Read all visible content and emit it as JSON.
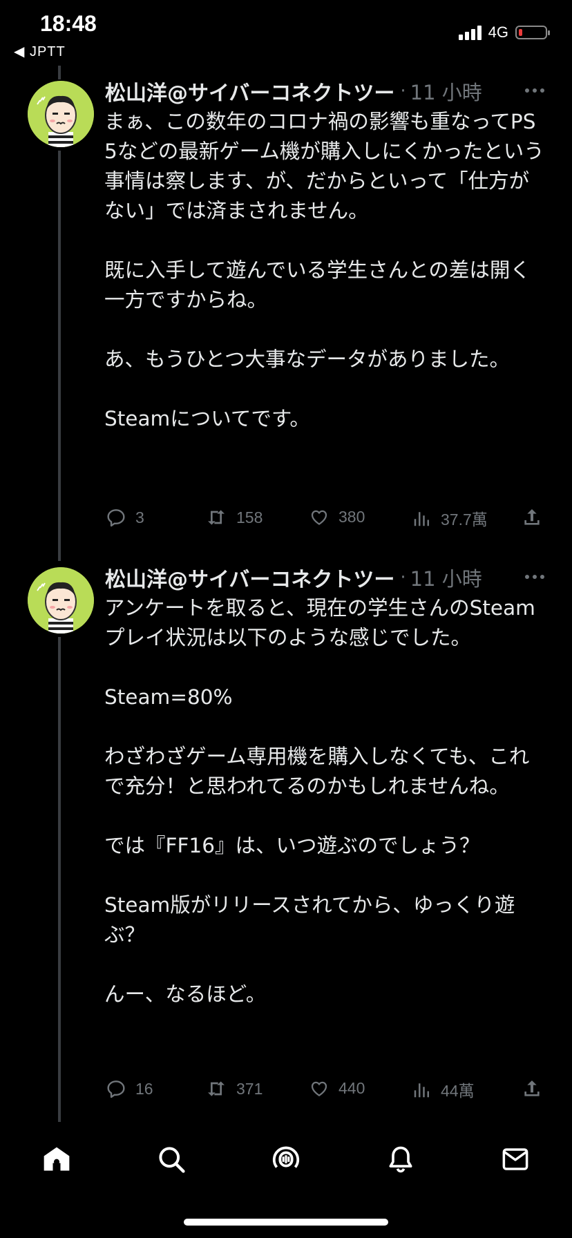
{
  "status_bar": {
    "time": "18:48",
    "back_label": "◀ JPTT",
    "network": "4G",
    "battery_level": 0.15,
    "battery_color": "#eb3b3b"
  },
  "tweets": [
    {
      "author": "松山洋@サイバーコネクトツー",
      "time": "11 小時",
      "text": "まぁ、この数年のコロナ禍の影響も重なってPS5などの最新ゲーム機が購入しにくかったという事情は察します、が、だからといって「仕方がない」では済まされません。\n\n既に入手して遊んでいる学生さんとの差は開く一方ですからね。\n\nあ、もうひとつ大事なデータがありました。\n\nSteamについてです。",
      "replies": "3",
      "retweets": "158",
      "likes": "380",
      "views": "37.7萬"
    },
    {
      "author": "松山洋@サイバーコネクトツー",
      "time": "11 小時",
      "text": "アンケートを取ると、現在の学生さんのSteamプレイ状況は以下のような感じでした。\n\nSteam=80%\n\nわざわざゲーム専用機を購入しなくても、これで充分！と思われてるのかもしれませんね。\n\nでは『FF16』は、いつ遊ぶのでしょう？\n\nSteam版がリリースされてから、ゆっくり遊ぶ？\n\nんー、なるほど。",
      "replies": "16",
      "retweets": "371",
      "likes": "440",
      "views": "44萬"
    }
  ],
  "bottom_nav": [
    "home-icon",
    "search-icon",
    "spaces-icon",
    "notifications-icon",
    "messages-icon"
  ],
  "colors": {
    "background": "#000000",
    "text": "#e7e9ea",
    "muted": "#71767b",
    "avatar_bg": "#b9dc57"
  }
}
